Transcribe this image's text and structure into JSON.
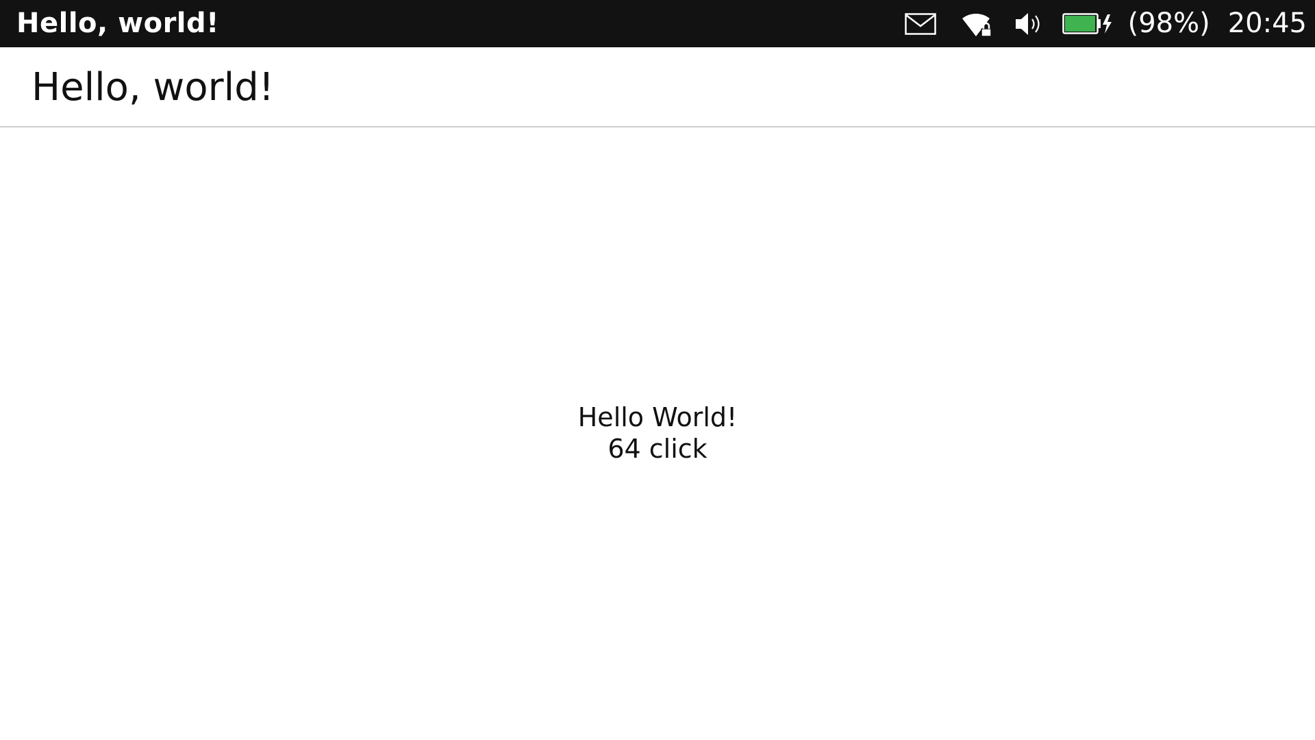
{
  "status_bar": {
    "app_title": "Hello, world!",
    "indicators": {
      "mail_icon": "mail-icon",
      "wifi_icon": "wifi-locked-icon",
      "sound_icon": "volume-icon",
      "battery_icon": "battery-charging-icon",
      "battery_level": 0.98,
      "battery_text": "(98%)",
      "clock": "20:45"
    },
    "colors": {
      "background": "#121212",
      "battery_fill": "#3eb34f"
    }
  },
  "header": {
    "title": "Hello, world!"
  },
  "main": {
    "greeting": "Hello World!",
    "click_count": "64 click"
  }
}
